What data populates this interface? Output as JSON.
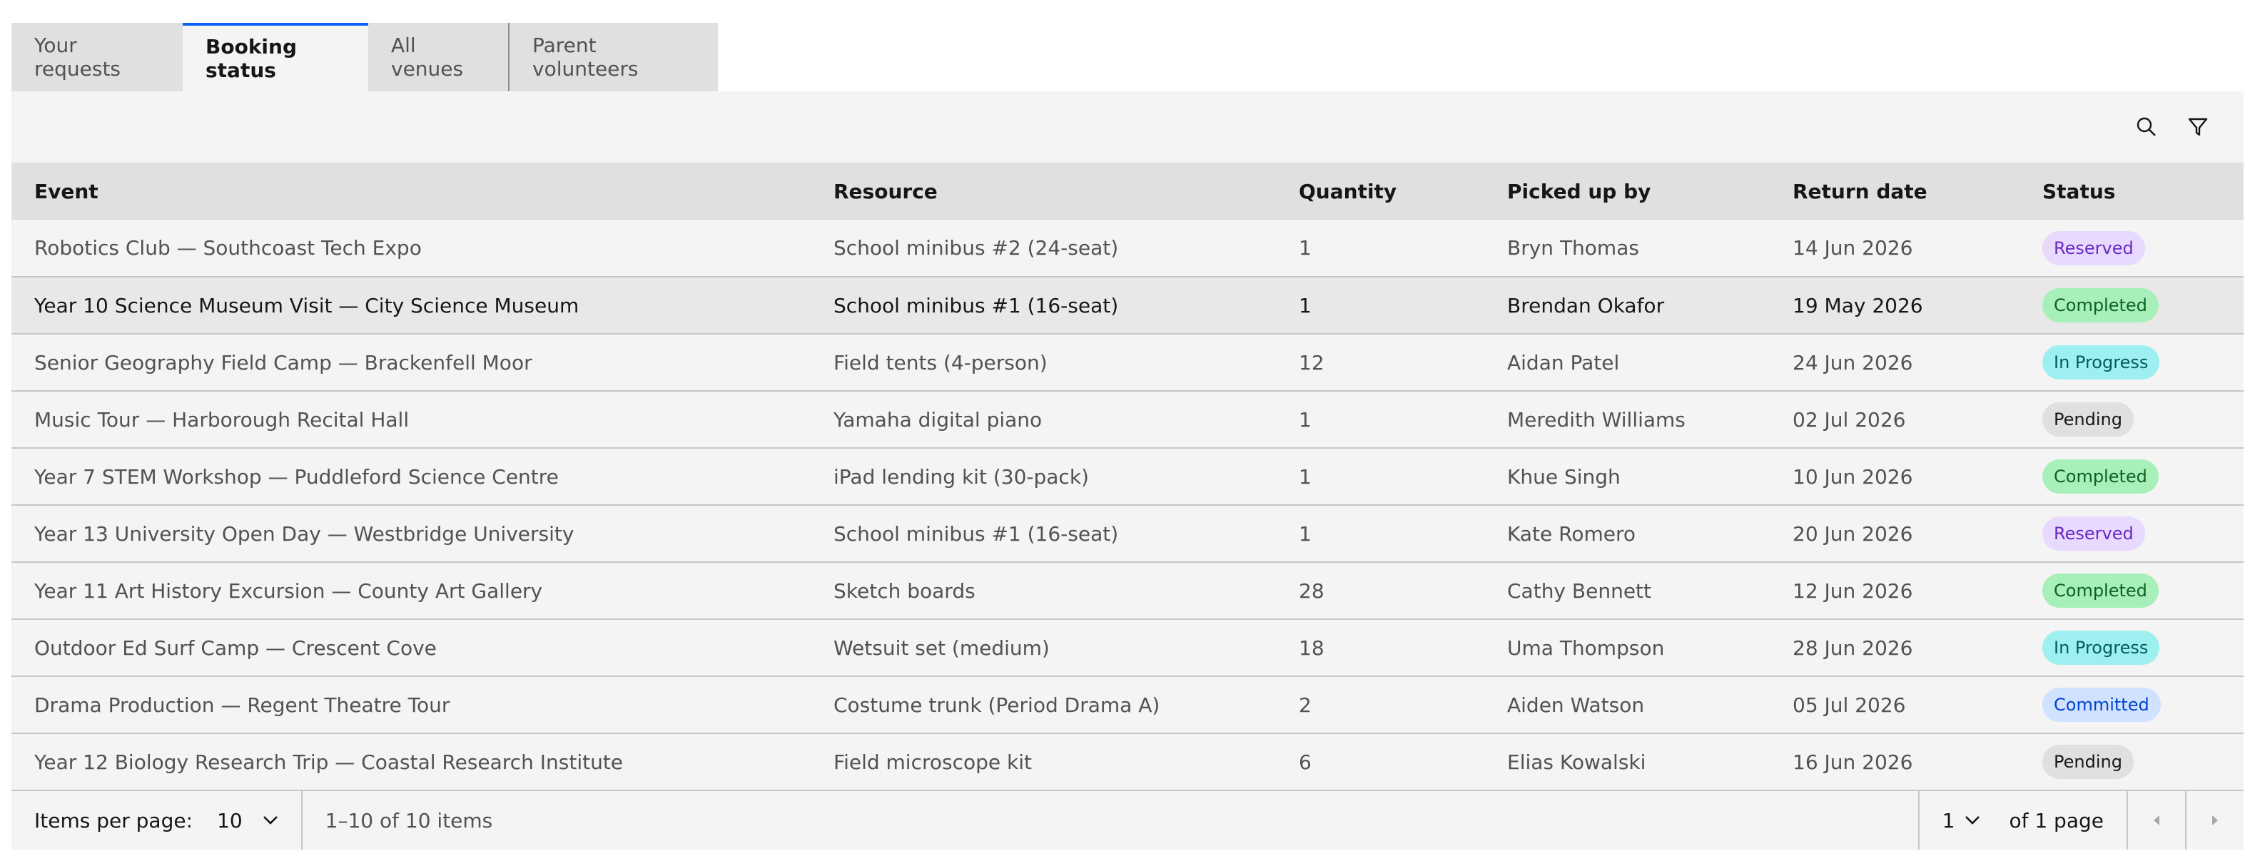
{
  "tabs": [
    {
      "label": "Your requests",
      "active": false
    },
    {
      "label": "Booking status",
      "active": true
    },
    {
      "label": "All venues",
      "active": false
    },
    {
      "label": "Parent volunteers",
      "active": false
    }
  ],
  "toolbar": {
    "search_icon": "search-icon",
    "filter_icon": "filter-icon"
  },
  "table": {
    "headers": [
      "Event",
      "Resource",
      "Quantity",
      "Picked up by",
      "Return date",
      "Status"
    ],
    "rows": [
      {
        "event": "Robotics Club — Southcoast Tech Expo",
        "resource": "School minibus #2 (24-seat)",
        "quantity": "1",
        "picked_up_by": "Bryn Thomas",
        "return_date": "14 Jun 2026",
        "status": "Reserved"
      },
      {
        "event": "Year 10 Science Museum Visit — City Science Museum",
        "resource": "School minibus #1 (16-seat)",
        "quantity": "1",
        "picked_up_by": "Brendan Okafor",
        "return_date": "19 May 2026",
        "status": "Completed"
      },
      {
        "event": "Senior Geography Field Camp — Brackenfell Moor",
        "resource": "Field tents (4-person)",
        "quantity": "12",
        "picked_up_by": "Aidan Patel",
        "return_date": "24 Jun 2026",
        "status": "In Progress"
      },
      {
        "event": "Music Tour — Harborough Recital Hall",
        "resource": "Yamaha digital piano",
        "quantity": "1",
        "picked_up_by": "Meredith Williams",
        "return_date": "02 Jul 2026",
        "status": "Pending"
      },
      {
        "event": "Year 7 STEM Workshop — Puddleford Science Centre",
        "resource": "iPad lending kit (30-pack)",
        "quantity": "1",
        "picked_up_by": "Khue Singh",
        "return_date": "10 Jun 2026",
        "status": "Completed"
      },
      {
        "event": "Year 13 University Open Day — Westbridge University",
        "resource": "School minibus #1 (16-seat)",
        "quantity": "1",
        "picked_up_by": "Kate Romero",
        "return_date": "20 Jun 2026",
        "status": "Reserved"
      },
      {
        "event": "Year 11 Art History Excursion — County Art Gallery",
        "resource": "Sketch boards",
        "quantity": "28",
        "picked_up_by": "Cathy Bennett",
        "return_date": "12 Jun 2026",
        "status": "Completed"
      },
      {
        "event": "Outdoor Ed Surf Camp — Crescent Cove",
        "resource": "Wetsuit set (medium)",
        "quantity": "18",
        "picked_up_by": "Uma Thompson",
        "return_date": "28 Jun 2026",
        "status": "In Progress"
      },
      {
        "event": "Drama Production — Regent Theatre Tour",
        "resource": "Costume trunk (Period Drama A)",
        "quantity": "2",
        "picked_up_by": "Aiden Watson",
        "return_date": "05 Jul 2026",
        "status": "Committed"
      },
      {
        "event": "Year 12 Biology Research Trip — Coastal Research Institute",
        "resource": "Field microscope kit",
        "quantity": "6",
        "picked_up_by": "Elias Kowalski",
        "return_date": "16 Jun 2026",
        "status": "Pending"
      }
    ]
  },
  "status_colors": {
    "Reserved": {
      "bg": "#e8daff",
      "fg": "#6929c4"
    },
    "Completed": {
      "bg": "#a7f0ba",
      "fg": "#0e6027"
    },
    "In Progress": {
      "bg": "#9ef0f0",
      "fg": "#005d5d"
    },
    "Pending": {
      "bg": "#e0e0e0",
      "fg": "#161616"
    },
    "Committed": {
      "bg": "#d0e2ff",
      "fg": "#0043ce"
    }
  },
  "pagination": {
    "items_per_page_label": "Items per page:",
    "items_per_page": "10",
    "range_text": "1–10 of 10 items",
    "page": "1",
    "of_pages_text": "of 1 page"
  },
  "colors": {
    "accent": "#0f62fe"
  }
}
